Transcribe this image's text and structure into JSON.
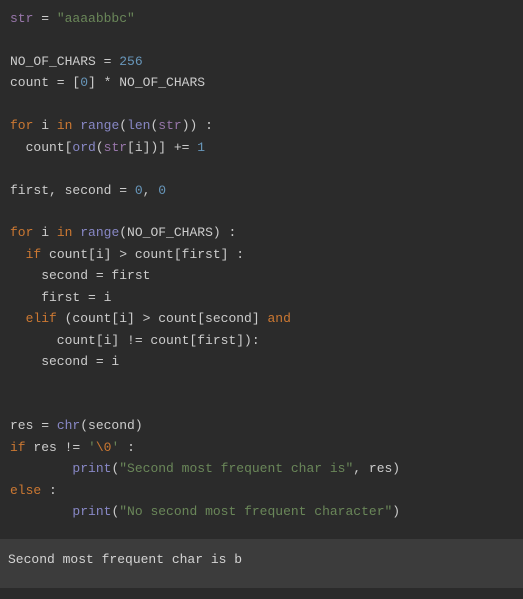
{
  "code": {
    "l1a": "str",
    "l1b": " = ",
    "l1c": "\"aaaabbbc\"",
    "l3a": "NO_OF_CHARS = ",
    "l3b": "256",
    "l4a": "count = [",
    "l4b": "0",
    "l4c": "] * NO_OF_CHARS",
    "l6a": "for",
    "l6b": " i ",
    "l6c": "in",
    "l6d": " ",
    "l6e": "range",
    "l6f": "(",
    "l6g": "len",
    "l6h": "(",
    "l6i": "str",
    "l6j": ")) :",
    "l7a": "  count[",
    "l7b": "ord",
    "l7c": "(",
    "l7d": "str",
    "l7e": "[i])] += ",
    "l7f": "1",
    "l9a": "first, second = ",
    "l9b": "0",
    "l9c": ", ",
    "l9d": "0",
    "l11a": "for",
    "l11b": " i ",
    "l11c": "in",
    "l11d": " ",
    "l11e": "range",
    "l11f": "(NO_OF_CHARS) :",
    "l12a": "  ",
    "l12b": "if",
    "l12c": " count[i] > count[first] :",
    "l13": "    second = first",
    "l14": "    first = i",
    "l15a": "  ",
    "l15b": "elif",
    "l15c": " (count[i] > count[second] ",
    "l15d": "and",
    "l16": "      count[i] != count[first]):",
    "l17": "    second = i",
    "l20a": "res = ",
    "l20b": "chr",
    "l20c": "(second)",
    "l21a": "if",
    "l21b": " res != ",
    "l21c": "'",
    "l21d": "\\0",
    "l21e": "'",
    "l21f": " :",
    "l22a": "        ",
    "l22b": "print",
    "l22c": "(",
    "l22d": "\"Second most frequent char is\"",
    "l22e": ", res)",
    "l23a": "else",
    "l23b": " :",
    "l24a": "        ",
    "l24b": "print",
    "l24c": "(",
    "l24d": "\"No second most frequent character\"",
    "l24e": ")"
  },
  "output": "Second most frequent char is b"
}
